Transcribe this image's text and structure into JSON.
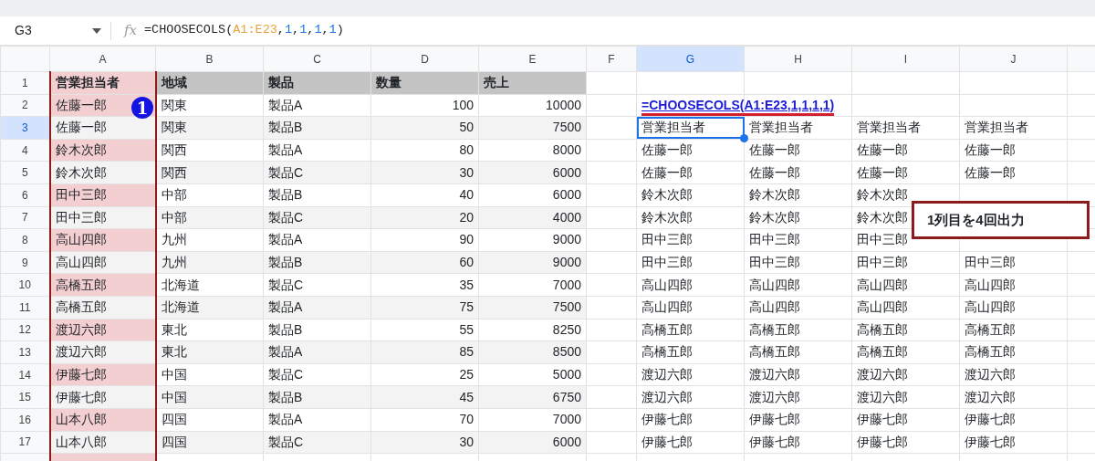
{
  "formula_bar": {
    "name_box": "G3",
    "fx": "fx",
    "tokens": [
      {
        "text": "=CHOOSECOLS(",
        "kind": "plain"
      },
      {
        "text": "A1:E23",
        "kind": "range"
      },
      {
        "text": ",",
        "kind": "plain"
      },
      {
        "text": "1",
        "kind": "number"
      },
      {
        "text": ",",
        "kind": "plain"
      },
      {
        "text": "1",
        "kind": "number"
      },
      {
        "text": ",",
        "kind": "plain"
      },
      {
        "text": "1",
        "kind": "number"
      },
      {
        "text": ",",
        "kind": "plain"
      },
      {
        "text": "1",
        "kind": "number"
      },
      {
        "text": ")",
        "kind": "plain"
      }
    ]
  },
  "columns": [
    {
      "label": "A",
      "selected": false,
      "highlighted": true
    },
    {
      "label": "B",
      "selected": false,
      "highlighted": false
    },
    {
      "label": "C",
      "selected": false,
      "highlighted": false
    },
    {
      "label": "D",
      "selected": false,
      "highlighted": false
    },
    {
      "label": "E",
      "selected": false,
      "highlighted": false
    },
    {
      "label": "F",
      "selected": false,
      "highlighted": false
    },
    {
      "label": "G",
      "selected": true,
      "highlighted": false
    },
    {
      "label": "H",
      "selected": false,
      "highlighted": false
    },
    {
      "label": "I",
      "selected": false,
      "highlighted": false
    },
    {
      "label": "J",
      "selected": false,
      "highlighted": false
    }
  ],
  "rows": [
    {
      "number": "1",
      "selected": false,
      "source": [
        "営業担当者",
        "地域",
        "製品",
        "数量",
        "売上"
      ]
    },
    {
      "number": "2",
      "selected": false,
      "source": [
        "佐藤一郎",
        "関東",
        "製品A",
        "100",
        "10000"
      ],
      "formula": "=CHOOSECOLS(A1:E23,1,1,1,1)"
    },
    {
      "number": "3",
      "selected": true,
      "source": [
        "佐藤一郎",
        "関東",
        "製品B",
        "50",
        "7500"
      ],
      "output": [
        "営業担当者",
        "営業担当者",
        "営業担当者",
        "営業担当者"
      ]
    },
    {
      "number": "4",
      "selected": false,
      "source": [
        "鈴木次郎",
        "関西",
        "製品A",
        "80",
        "8000"
      ],
      "output": [
        "佐藤一郎",
        "佐藤一郎",
        "佐藤一郎",
        "佐藤一郎"
      ]
    },
    {
      "number": "5",
      "selected": false,
      "source": [
        "鈴木次郎",
        "関西",
        "製品C",
        "30",
        "6000"
      ],
      "output": [
        "佐藤一郎",
        "佐藤一郎",
        "佐藤一郎",
        "佐藤一郎"
      ]
    },
    {
      "number": "6",
      "selected": false,
      "source": [
        "田中三郎",
        "中部",
        "製品B",
        "40",
        "6000"
      ],
      "output": [
        "鈴木次郎",
        "鈴木次郎",
        "鈴木次郎"
      ]
    },
    {
      "number": "7",
      "selected": false,
      "source": [
        "田中三郎",
        "中部",
        "製品C",
        "20",
        "4000"
      ],
      "output": [
        "鈴木次郎",
        "鈴木次郎",
        "鈴木次郎"
      ]
    },
    {
      "number": "8",
      "selected": false,
      "source": [
        "高山四郎",
        "九州",
        "製品A",
        "90",
        "9000"
      ],
      "output": [
        "田中三郎",
        "田中三郎",
        "田中三郎"
      ]
    },
    {
      "number": "9",
      "selected": false,
      "source": [
        "高山四郎",
        "九州",
        "製品B",
        "60",
        "9000"
      ],
      "output": [
        "田中三郎",
        "田中三郎",
        "田中三郎",
        "田中三郎"
      ]
    },
    {
      "number": "10",
      "selected": false,
      "source": [
        "高橋五郎",
        "北海道",
        "製品C",
        "35",
        "7000"
      ],
      "output": [
        "高山四郎",
        "高山四郎",
        "高山四郎",
        "高山四郎"
      ]
    },
    {
      "number": "11",
      "selected": false,
      "source": [
        "高橋五郎",
        "北海道",
        "製品A",
        "75",
        "7500"
      ],
      "output": [
        "高山四郎",
        "高山四郎",
        "高山四郎",
        "高山四郎"
      ]
    },
    {
      "number": "12",
      "selected": false,
      "source": [
        "渡辺六郎",
        "東北",
        "製品B",
        "55",
        "8250"
      ],
      "output": [
        "高橋五郎",
        "高橋五郎",
        "高橋五郎",
        "高橋五郎"
      ]
    },
    {
      "number": "13",
      "selected": false,
      "source": [
        "渡辺六郎",
        "東北",
        "製品A",
        "85",
        "8500"
      ],
      "output": [
        "高橋五郎",
        "高橋五郎",
        "高橋五郎",
        "高橋五郎"
      ]
    },
    {
      "number": "14",
      "selected": false,
      "source": [
        "伊藤七郎",
        "中国",
        "製品C",
        "25",
        "5000"
      ],
      "output": [
        "渡辺六郎",
        "渡辺六郎",
        "渡辺六郎",
        "渡辺六郎"
      ]
    },
    {
      "number": "15",
      "selected": false,
      "source": [
        "伊藤七郎",
        "中国",
        "製品B",
        "45",
        "6750"
      ],
      "output": [
        "渡辺六郎",
        "渡辺六郎",
        "渡辺六郎",
        "渡辺六郎"
      ]
    },
    {
      "number": "16",
      "selected": false,
      "source": [
        "山本八郎",
        "四国",
        "製品A",
        "70",
        "7000"
      ],
      "output": [
        "伊藤七郎",
        "伊藤七郎",
        "伊藤七郎",
        "伊藤七郎"
      ]
    },
    {
      "number": "17",
      "selected": false,
      "source": [
        "山本八郎",
        "四国",
        "製品C",
        "30",
        "6000"
      ],
      "output": [
        "伊藤七郎",
        "伊藤七郎",
        "伊藤七郎",
        "伊藤七郎"
      ]
    }
  ],
  "marker": {
    "text": "1"
  },
  "callout": {
    "text": "1列目を4回出力"
  }
}
